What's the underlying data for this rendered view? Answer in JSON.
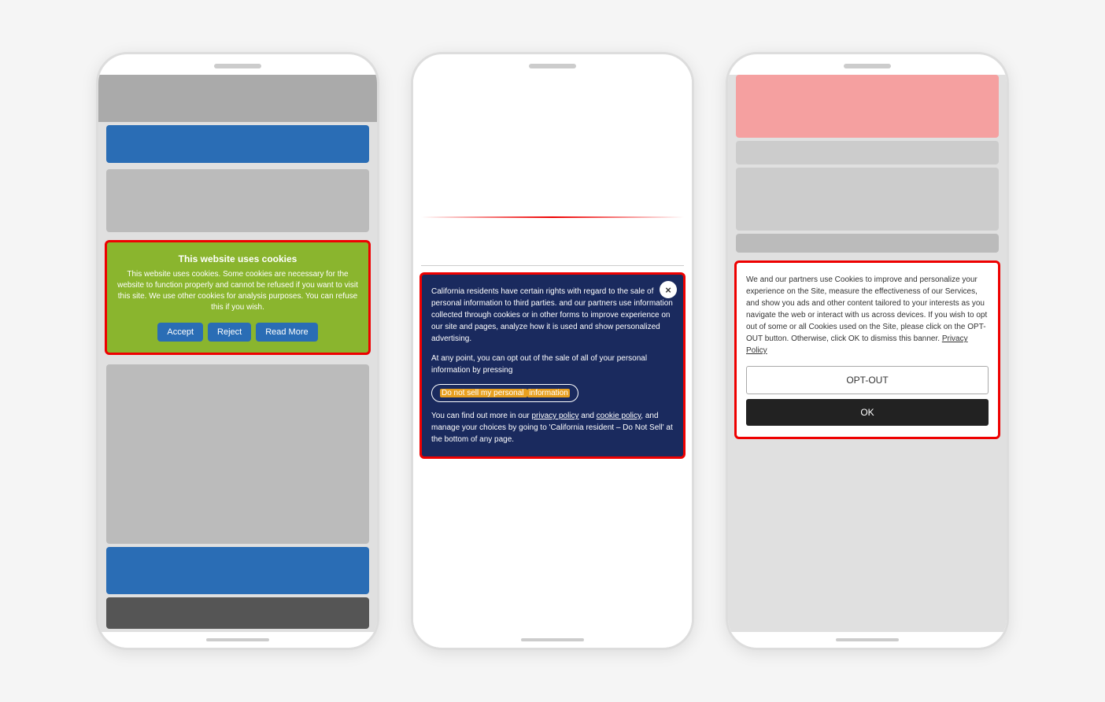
{
  "page": {
    "background": "#f5f5f5"
  },
  "phone1": {
    "speaker": "speaker",
    "cookie_banner": {
      "title": "This website uses cookies",
      "text": "This website uses cookies. Some cookies are necessary for the website to function properly and cannot be refused if you want to visit this site. We use other cookies for analysis purposes. You can refuse this if you wish.",
      "btn_accept": "Accept",
      "btn_reject": "Reject",
      "btn_read_more": "Read More"
    }
  },
  "phone2": {
    "cookie_banner": {
      "close_icon": "×",
      "text1": "California residents have certain rights with regard to the sale of personal information to third parties.",
      "text2": "and our partners use information collected through cookies or in other forms to improve experience on our site and pages, analyze how it is used and show personalized advertising.",
      "text3": "At any point, you can opt out of the sale of all of your personal information by pressing",
      "opt_btn_label": "Do not sell my personal ",
      "opt_btn_highlight": "information",
      "text4": "You can find out more in our ",
      "link1": "privacy policy",
      "and_text": " and ",
      "link2": "cookie policy",
      "text5": ", and manage your choices by going to 'California resident – Do Not Sell' at the bottom of any page."
    }
  },
  "phone3": {
    "cookie_banner": {
      "text": "We and our partners use Cookies to improve and personalize your experience on the Site, measure the effectiveness of our Services, and show you ads and other content tailored to your interests as you navigate the web or interact with us across devices. If you wish to opt out of some or all Cookies used on the Site, please click on the OPT-OUT button. Otherwise, click OK to dismiss this banner.",
      "privacy_link": "Privacy Policy",
      "opt_out_btn": "OPT-OUT",
      "ok_btn": "OK"
    }
  }
}
